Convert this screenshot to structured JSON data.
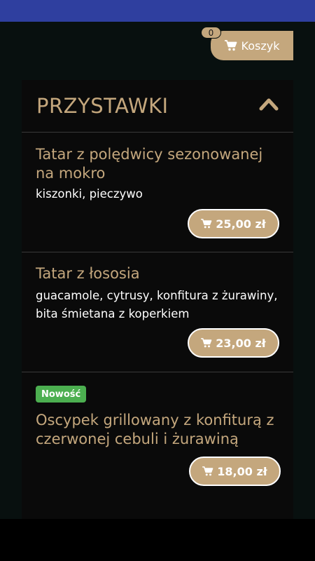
{
  "cart": {
    "label": "Koszyk",
    "count": "0",
    "icon": "cart-icon"
  },
  "section": {
    "title": "PRZYSTAWKI",
    "toggle_icon": "chevron-up-icon"
  },
  "items": [
    {
      "name": "Tatar z polędwicy sezonowanej na mokro",
      "description": "kiszonki, pieczywo",
      "price": "25,00 zł",
      "badge": ""
    },
    {
      "name": "Tatar z łososia",
      "description": "guacamole, cytrusy, konfitura z żurawiny, bita śmietana z koperkiem",
      "price": "23,00 zł",
      "badge": ""
    },
    {
      "name": "Oscypek grillowany z konfiturą z czerwonej cebuli i żurawiną",
      "description": "",
      "price": "18,00 zł",
      "badge": "Nowość"
    }
  ],
  "colors": {
    "accent": "#c4a77d",
    "status_bar": "#2f3f9f",
    "background": "#08100f",
    "new_badge": "#4caf50"
  }
}
